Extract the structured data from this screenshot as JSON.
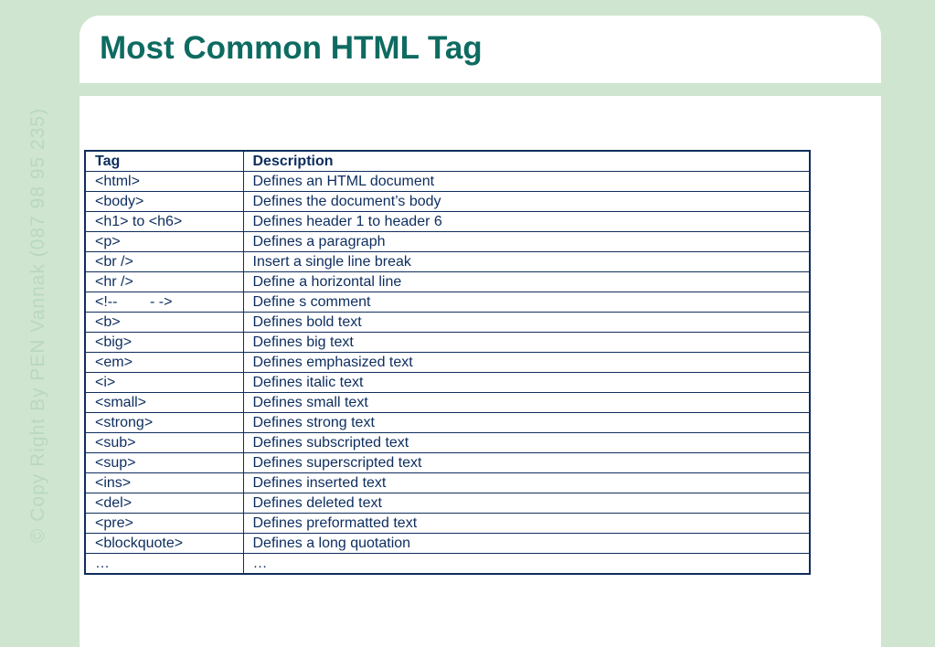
{
  "slide": {
    "title": "Most Common HTML Tag",
    "watermark": "© Copy Right By PEN Vannak (087 98 95 235)"
  },
  "table": {
    "headers": [
      "Tag",
      "Description"
    ],
    "rows": [
      {
        "tag": "<html>",
        "description": "Defines an HTML document"
      },
      {
        "tag": "<body>",
        "description": "Defines the document’s body"
      },
      {
        "tag": "<h1> to <h6>",
        "description": "Defines header 1 to header 6"
      },
      {
        "tag": "<p>",
        "description": "Defines a paragraph"
      },
      {
        "tag": "<br />",
        "description": "Insert a single line break"
      },
      {
        "tag": "<hr />",
        "description": "Define a horizontal line"
      },
      {
        "tag": "<!--        - ->",
        "description": "Define s comment"
      },
      {
        "tag": "<b>",
        "description": "Defines bold text"
      },
      {
        "tag": "<big>",
        "description": "Defines big text"
      },
      {
        "tag": "<em>",
        "description": "Defines emphasized text"
      },
      {
        "tag": "<i>",
        "description": "Defines italic text"
      },
      {
        "tag": "<small>",
        "description": "Defines small text"
      },
      {
        "tag": "<strong>",
        "description": "Defines strong text"
      },
      {
        "tag": "<sub>",
        "description": "Defines subscripted text"
      },
      {
        "tag": "<sup>",
        "description": "Defines superscripted text"
      },
      {
        "tag": "<ins>",
        "description": "Defines inserted text"
      },
      {
        "tag": "<del>",
        "description": "Defines deleted text"
      },
      {
        "tag": "<pre>",
        "description": "Defines preformatted text"
      },
      {
        "tag": "<blockquote>",
        "description": "Defines a long quotation"
      },
      {
        "tag": "…",
        "description": "…"
      }
    ]
  },
  "colors": {
    "background": "#cfe5cf",
    "title": "#0e6b61",
    "table_text": "#0d2d5e",
    "table_border": "#102e5c",
    "watermark": "#b9d8bf"
  }
}
